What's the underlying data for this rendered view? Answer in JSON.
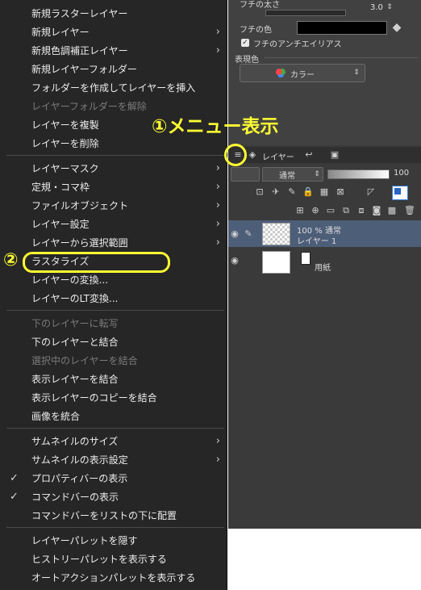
{
  "menu": {
    "items": [
      {
        "label": "新規ラスターレイヤー",
        "disabled": false,
        "submenu": false,
        "checked": false
      },
      {
        "label": "新規レイヤー",
        "disabled": false,
        "submenu": true,
        "checked": false
      },
      {
        "label": "新規色調補正レイヤー",
        "disabled": false,
        "submenu": true,
        "checked": false
      },
      {
        "label": "新規レイヤーフォルダー",
        "disabled": false,
        "submenu": false,
        "checked": false
      },
      {
        "label": "フォルダーを作成してレイヤーを挿入",
        "disabled": false,
        "submenu": false,
        "checked": false
      },
      {
        "label": "レイヤーフォルダーを解除",
        "disabled": true,
        "submenu": false,
        "checked": false
      },
      {
        "label": "レイヤーを複製",
        "disabled": false,
        "submenu": false,
        "checked": false
      },
      {
        "label": "レイヤーを削除",
        "disabled": false,
        "submenu": false,
        "checked": false
      },
      {
        "label": "レイヤーマスク",
        "disabled": false,
        "submenu": true,
        "checked": false
      },
      {
        "label": "定規・コマ枠",
        "disabled": false,
        "submenu": true,
        "checked": false
      },
      {
        "label": "ファイルオブジェクト",
        "disabled": false,
        "submenu": true,
        "checked": false
      },
      {
        "label": "レイヤー設定",
        "disabled": false,
        "submenu": true,
        "checked": false
      },
      {
        "label": "レイヤーから選択範囲",
        "disabled": false,
        "submenu": true,
        "checked": false
      },
      {
        "label": "ラスタライズ",
        "disabled": false,
        "submenu": false,
        "checked": false
      },
      {
        "label": "レイヤーの変換...",
        "disabled": false,
        "submenu": false,
        "checked": false
      },
      {
        "label": "レイヤーのLT変換...",
        "disabled": false,
        "submenu": false,
        "checked": false
      },
      {
        "label": "下のレイヤーに転写",
        "disabled": true,
        "submenu": false,
        "checked": false
      },
      {
        "label": "下のレイヤーと結合",
        "disabled": false,
        "submenu": false,
        "checked": false
      },
      {
        "label": "選択中のレイヤーを結合",
        "disabled": true,
        "submenu": false,
        "checked": false
      },
      {
        "label": "表示レイヤーを結合",
        "disabled": false,
        "submenu": false,
        "checked": false
      },
      {
        "label": "表示レイヤーのコピーを結合",
        "disabled": false,
        "submenu": false,
        "checked": false
      },
      {
        "label": "画像を統合",
        "disabled": false,
        "submenu": false,
        "checked": false
      },
      {
        "label": "サムネイルのサイズ",
        "disabled": false,
        "submenu": true,
        "checked": false
      },
      {
        "label": "サムネイルの表示設定",
        "disabled": false,
        "submenu": true,
        "checked": false
      },
      {
        "label": "プロパティバーの表示",
        "disabled": false,
        "submenu": false,
        "checked": true
      },
      {
        "label": "コマンドバーの表示",
        "disabled": false,
        "submenu": false,
        "checked": true
      },
      {
        "label": "コマンドバーをリストの下に配置",
        "disabled": false,
        "submenu": false,
        "checked": false
      },
      {
        "label": "レイヤーパレットを隠す",
        "disabled": false,
        "submenu": false,
        "checked": false
      },
      {
        "label": "ヒストリーパレットを表示する",
        "disabled": false,
        "submenu": false,
        "checked": false
      },
      {
        "label": "オートアクションパレットを表示する",
        "disabled": false,
        "submenu": false,
        "checked": false
      }
    ],
    "arrow_glyph": "›",
    "check_glyph": "✓"
  },
  "annotations": {
    "step1": "①メニュー表示",
    "step2": "②",
    "color": "#ffff33"
  },
  "properties": {
    "border_width_label": "フチの太さ",
    "border_width_value": "3.0",
    "border_color_label": "フチの色",
    "antialias_label": "フチのアンチエイリアス",
    "expression_color_label": "表現色",
    "expression_color_value": "カラー"
  },
  "layer_palette": {
    "tab_label": "レイヤー",
    "blend_mode": "通常",
    "opacity": "100",
    "layers": [
      {
        "info": "100 % 通常",
        "name": "レイヤー 1",
        "selected": true
      },
      {
        "info": "",
        "name": "用紙",
        "selected": false
      }
    ]
  },
  "colors": {
    "menu_bg": "#262626",
    "panel_bg": "#3a3a3a",
    "selected_layer": "#4d5e79",
    "disabled_text": "#7a7a7a"
  }
}
